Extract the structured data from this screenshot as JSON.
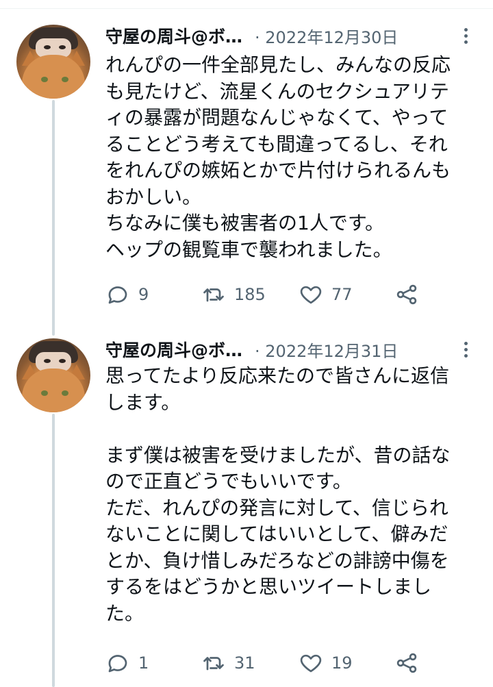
{
  "tweets": [
    {
      "author": "守屋の周斗@ボ…",
      "date": "· 2022年12月30日",
      "lines": [
        "れんぴの一件全部見たし、みんなの反応",
        "も見たけど、流星くんのセクシュアリテ",
        "ィの暴露が問題なんじゃなくて、やって",
        "ることどう考えても間違ってるし、それ",
        "をれんぴの嫉妬とかで片付けられるんも",
        "おかしい。",
        "ちなみに僕も被害者の1人です。",
        "ヘップの観覧車で襲われました。"
      ],
      "replies": "9",
      "retweets": "185",
      "likes": "77"
    },
    {
      "author": "守屋の周斗@ボ…",
      "date": "· 2022年12月31日",
      "lines": [
        "思ってたより反応来たので皆さんに返信",
        "します。",
        "",
        "まず僕は被害を受けましたが、昔の話な",
        "ので正直どうでもいいです。",
        "ただ、れんぴの発言に対して、信じられ",
        "ないことに関してはいいとして、僻みだ",
        "とか、負け惜しみだろなどの誹謗中傷を",
        "するをはどうかと思いツイートしまし",
        "た。"
      ],
      "replies": "1",
      "retweets": "31",
      "likes": "19"
    }
  ],
  "colors": {
    "text": "#0f1419",
    "muted": "#536471",
    "thread": "#cfd9de"
  },
  "icons": [
    "reply-icon",
    "retweet-icon",
    "like-icon",
    "share-icon",
    "more-icon"
  ]
}
